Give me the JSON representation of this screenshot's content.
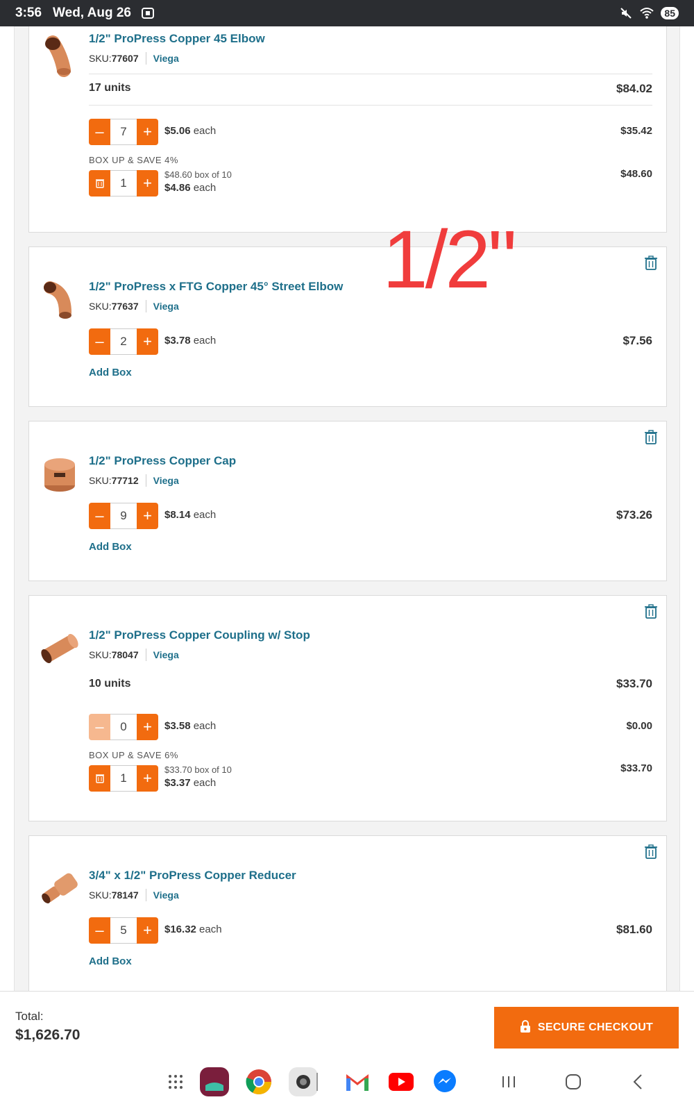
{
  "status_bar": {
    "time": "3:56",
    "date": "Wed, Aug 26",
    "battery": "85"
  },
  "overlay_annotation": "1/2\"",
  "items": [
    {
      "title": "1/2\" ProPress Copper 45 Elbow",
      "sku_label": "SKU:",
      "sku": "77607",
      "brand": "Viega",
      "units": "17 units",
      "units_total": "$84.02",
      "qty": "7",
      "each_price": "$5.06",
      "each_suffix": " each",
      "line_total": "$35.42",
      "boxup_label": "BOX UP & SAVE 4%",
      "box_qty": "1",
      "box_of": "$48.60 box of 10",
      "box_each": "$4.86",
      "box_total": "$48.60"
    },
    {
      "title": "1/2\" ProPress x FTG Copper 45° Street Elbow",
      "sku_label": "SKU:",
      "sku": "77637",
      "brand": "Viega",
      "qty": "2",
      "each_price": "$3.78",
      "each_suffix": " each",
      "line_total": "$7.56",
      "add_box": "Add Box"
    },
    {
      "title": "1/2\" ProPress Copper Cap",
      "sku_label": "SKU:",
      "sku": "77712",
      "brand": "Viega",
      "qty": "9",
      "each_price": "$8.14",
      "each_suffix": " each",
      "line_total": "$73.26",
      "add_box": "Add Box"
    },
    {
      "title": "1/2\" ProPress Copper Coupling w/ Stop",
      "sku_label": "SKU:",
      "sku": "78047",
      "brand": "Viega",
      "units": "10 units",
      "units_total": "$33.70",
      "qty": "0",
      "each_price": "$3.58",
      "each_suffix": " each",
      "line_total": "$0.00",
      "boxup_label": "BOX UP & SAVE 6%",
      "box_qty": "1",
      "box_of": "$33.70 box of 10",
      "box_each": "$3.37",
      "box_total": "$33.70"
    },
    {
      "title": "3/4\" x 1/2\" ProPress Copper Reducer",
      "sku_label": "SKU:",
      "sku": "78147",
      "brand": "Viega",
      "qty": "5",
      "each_price": "$16.32",
      "each_suffix": " each",
      "line_total": "$81.60",
      "add_box": "Add Box"
    }
  ],
  "footer": {
    "total_label": "Total:",
    "total_value": "$1,626.70",
    "checkout_label": "SECURE CHECKOUT"
  },
  "colors": {
    "accent": "#f26b0f",
    "link": "#1e6f8a",
    "annotation": "#f03c3c"
  },
  "dock_apps": [
    "apps-grid-icon",
    "app-icon",
    "chrome-icon",
    "camera-icon",
    "gmail-icon",
    "youtube-icon",
    "messenger-icon",
    "recents-icon",
    "home-icon",
    "back-icon"
  ]
}
